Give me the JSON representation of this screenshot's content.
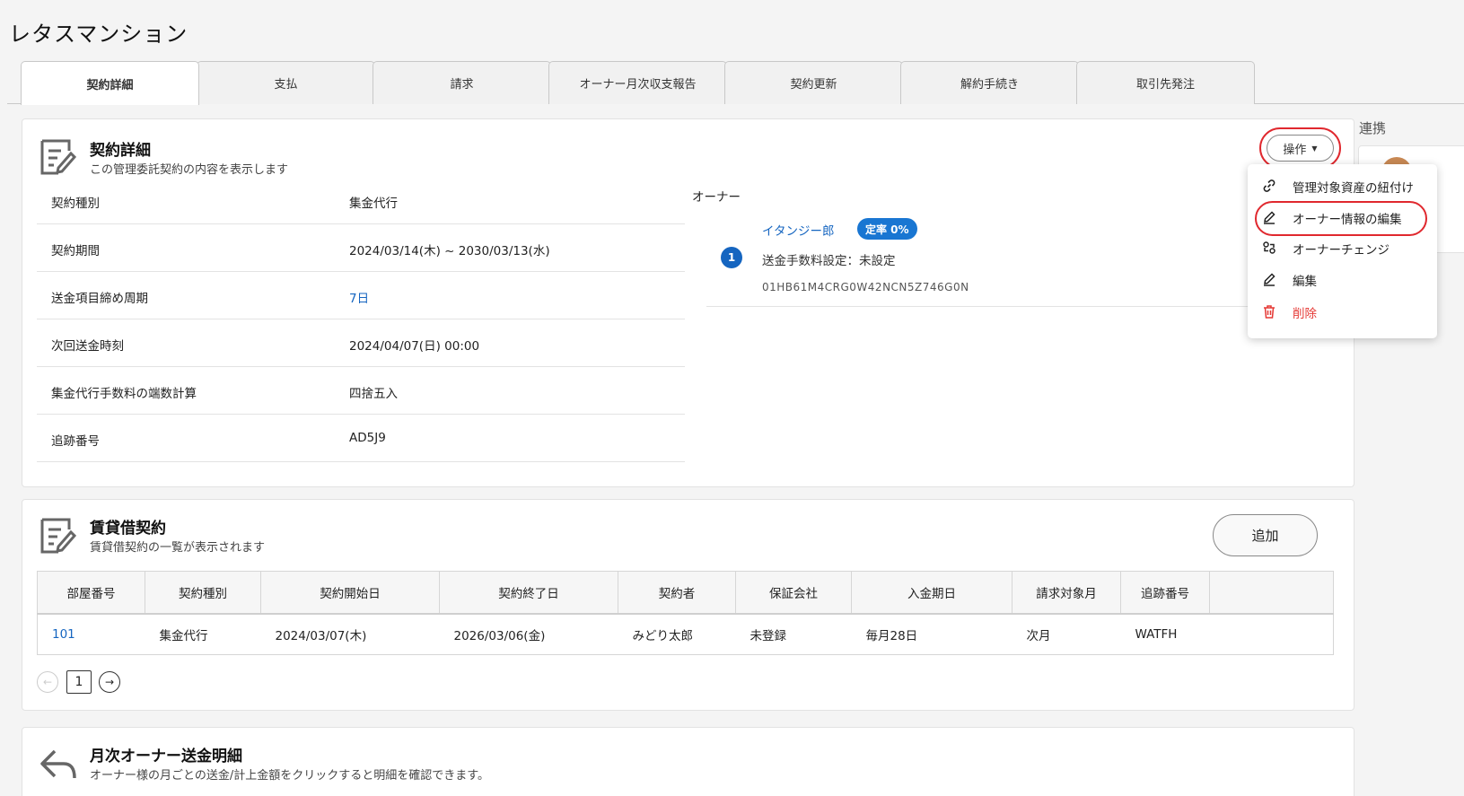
{
  "page_title": "レタスマンション",
  "tabs": [
    "契約詳細",
    "支払",
    "請求",
    "オーナー月次収支報告",
    "契約更新",
    "解約手続き",
    "取引先発注"
  ],
  "detail": {
    "title": "契約詳細",
    "subtitle": "この管理委託契約の内容を表示します",
    "ops_label": "操作",
    "rows": [
      {
        "label": "契約種別",
        "value": "集金代行"
      },
      {
        "label": "契約期間",
        "value": "2024/03/14(木) ~ 2030/03/13(水)"
      },
      {
        "label": "送金項目締め周期",
        "value": "7日"
      },
      {
        "label": "次回送金時刻",
        "value": "2024/04/07(日) 00:00"
      },
      {
        "label": "集金代行手数料の端数計算",
        "value": "四捨五入"
      },
      {
        "label": "追跡番号",
        "value": "AD5J9"
      }
    ],
    "owner_label": "オーナー",
    "owner": {
      "name": "イタンジー郎",
      "badge": "定率 0%",
      "number": "1",
      "fee_setting": "送金手数料設定：未設定",
      "id": "01HB61M4CRG0W42NCN5Z746G0N"
    }
  },
  "menu": {
    "items": [
      {
        "label": "管理対象資産の紐付け",
        "icon": "link-icon"
      },
      {
        "label": "オーナー情報の編集",
        "icon": "pencil-icon"
      },
      {
        "label": "オーナーチェンジ",
        "icon": "swap-icon"
      },
      {
        "label": "編集",
        "icon": "pencil-icon"
      },
      {
        "label": "削除",
        "icon": "trash-icon"
      }
    ]
  },
  "side": {
    "title": "連携"
  },
  "lease": {
    "title": "賃貸借契約",
    "subtitle": "賃貸借契約の一覧が表示されます",
    "add_label": "追加",
    "columns": [
      "部屋番号",
      "契約種別",
      "契約開始日",
      "契約終了日",
      "契約者",
      "保証会社",
      "入金期日",
      "請求対象月",
      "追跡番号"
    ],
    "rows": [
      [
        "101",
        "集金代行",
        "2024/03/07(木)",
        "2026/03/06(金)",
        "みどり太郎",
        "未登録",
        "毎月28日",
        "次月",
        "WATFH"
      ]
    ],
    "page": "1"
  },
  "remit": {
    "title": "月次オーナー送金明細",
    "subtitle": "オーナー様の月ごとの送金/計上金額をクリックすると明細を確認できます。"
  },
  "colors": {
    "accent": "#1565c0",
    "highlight": "#e0282e",
    "danger": "#e53935"
  }
}
